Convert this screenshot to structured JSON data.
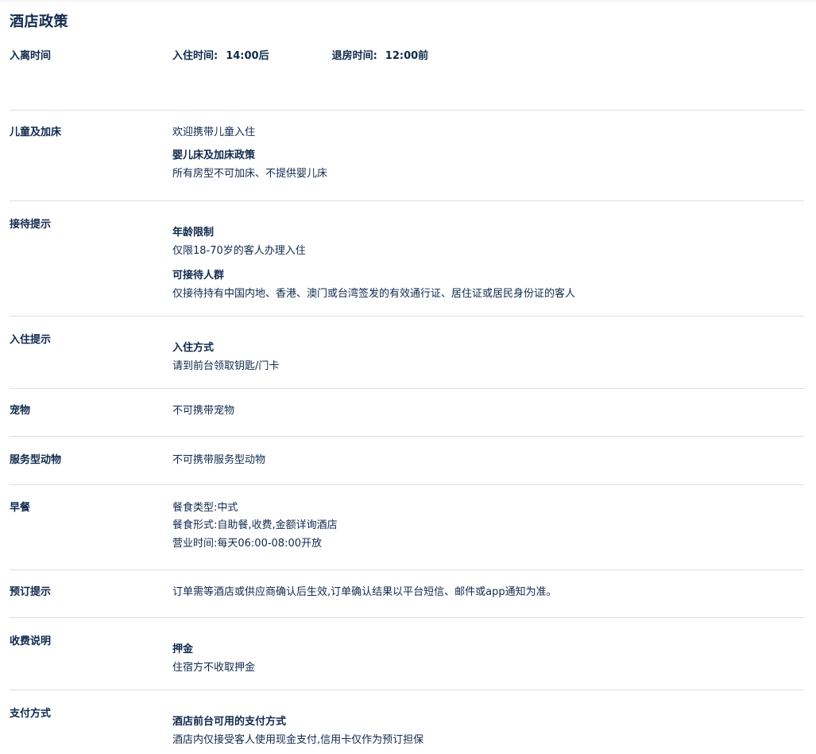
{
  "page": {
    "title": "酒店政策"
  },
  "checkin_time": {
    "label": "入离时间",
    "checkin_key": "入住时间:",
    "checkin_value": "14:00后",
    "checkout_key": "退房时间:",
    "checkout_value": "12:00前"
  },
  "children": {
    "label": "儿童及加床",
    "welcome": "欢迎携带儿童入住",
    "bed_title": "婴儿床及加床政策",
    "bed_text": "所有房型不可加床、不提供婴儿床"
  },
  "reception": {
    "label": "接待提示",
    "age_title": "年龄限制",
    "age_text": "仅限18-70岁的客人办理入住",
    "guests_title": "可接待人群",
    "guests_text": "仅接待持有中国内地、香港、澳门或台湾签发的有效通行证、居住证或居民身份证的客人"
  },
  "checkin_tips": {
    "label": "入住提示",
    "method_title": "入住方式",
    "method_text": "请到前台领取钥匙/门卡"
  },
  "pets": {
    "label": "宠物",
    "text": "不可携带宠物"
  },
  "service_animals": {
    "label": "服务型动物",
    "text": "不可携带服务型动物"
  },
  "breakfast": {
    "label": "早餐",
    "type": "餐食类型:中式",
    "form": "餐食形式:自助餐,收费,金额详询酒店",
    "hours": "营业时间:每天06:00-08:00开放"
  },
  "booking": {
    "label": "预订提示",
    "text": "订单需等酒店或供应商确认后生效,订单确认结果以平台短信、邮件或app通知为准。"
  },
  "fees": {
    "label": "收费说明",
    "deposit_title": "押金",
    "deposit_text": "住宿方不收取押金"
  },
  "payment": {
    "label": "支付方式",
    "methods_title": "酒店前台可用的支付方式",
    "methods_text": "酒店内仅接受客人使用现金支付,信用卡仅作为预订担保"
  }
}
